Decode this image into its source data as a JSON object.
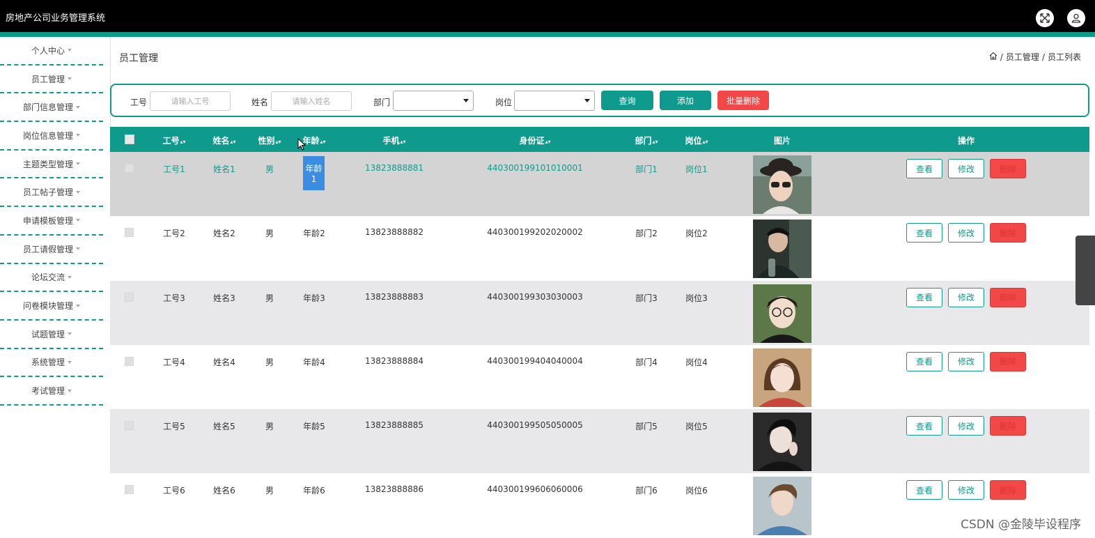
{
  "app": {
    "title": "房地产公司业务管理系统",
    "colors": {
      "accent": "#0e9a8c",
      "danger": "#f24848",
      "topbar": "#000000"
    }
  },
  "header_icons": [
    "fullscreen-icon",
    "user-icon"
  ],
  "sidebar": {
    "items": [
      {
        "label": "个人中心"
      },
      {
        "label": "员工管理"
      },
      {
        "label": "部门信息管理"
      },
      {
        "label": "岗位信息管理"
      },
      {
        "label": "主题类型管理"
      },
      {
        "label": "员工帖子管理"
      },
      {
        "label": "申请模板管理"
      },
      {
        "label": "员工请假管理"
      },
      {
        "label": "论坛交流"
      },
      {
        "label": "问卷模块管理"
      },
      {
        "label": "试题管理"
      },
      {
        "label": "系统管理"
      },
      {
        "label": "考试管理"
      }
    ]
  },
  "page": {
    "title": "员工管理",
    "breadcrumb": [
      "员工管理",
      "员工列表"
    ]
  },
  "search": {
    "gonghao_label": "工号",
    "gonghao_placeholder": "请输入工号",
    "xingming_label": "姓名",
    "xingming_placeholder": "请输入姓名",
    "bumen_label": "部门",
    "bumen_value": "",
    "gangwei_label": "岗位",
    "gangwei_value": "",
    "query_label": "查询",
    "add_label": "添加",
    "batch_delete_label": "批量删除"
  },
  "table": {
    "columns": [
      "工号",
      "姓名",
      "性别",
      "年龄",
      "手机",
      "身份证",
      "部门",
      "岗位",
      "图片",
      "操作"
    ],
    "rows": [
      {
        "gonghao": "工号1",
        "xingming": "姓名1",
        "xingbie": "男",
        "nianling": "年龄1",
        "shouji": "13823888881",
        "shenfenzheng": "440300199101010001",
        "bumen": "部门1",
        "gangwei": "岗位1"
      },
      {
        "gonghao": "工号2",
        "xingming": "姓名2",
        "xingbie": "男",
        "nianling": "年龄2",
        "shouji": "13823888882",
        "shenfenzheng": "440300199202020002",
        "bumen": "部门2",
        "gangwei": "岗位2"
      },
      {
        "gonghao": "工号3",
        "xingming": "姓名3",
        "xingbie": "男",
        "nianling": "年龄3",
        "shouji": "13823888883",
        "shenfenzheng": "440300199303030003",
        "bumen": "部门3",
        "gangwei": "岗位3"
      },
      {
        "gonghao": "工号4",
        "xingming": "姓名4",
        "xingbie": "男",
        "nianling": "年龄4",
        "shouji": "13823888884",
        "shenfenzheng": "440300199404040004",
        "bumen": "部门4",
        "gangwei": "岗位4"
      },
      {
        "gonghao": "工号5",
        "xingming": "姓名5",
        "xingbie": "男",
        "nianling": "年龄5",
        "shouji": "13823888885",
        "shenfenzheng": "440300199505050005",
        "bumen": "部门5",
        "gangwei": "岗位5"
      },
      {
        "gonghao": "工号6",
        "xingming": "姓名6",
        "xingbie": "男",
        "nianling": "年龄6",
        "shouji": "13823888886",
        "shenfenzheng": "440300199606060006",
        "bumen": "部门6",
        "gangwei": "岗位6"
      }
    ],
    "actions": {
      "view": "查看",
      "edit": "修改",
      "delete": "删除"
    }
  },
  "watermark": "CSDN @金陵毕设程序"
}
